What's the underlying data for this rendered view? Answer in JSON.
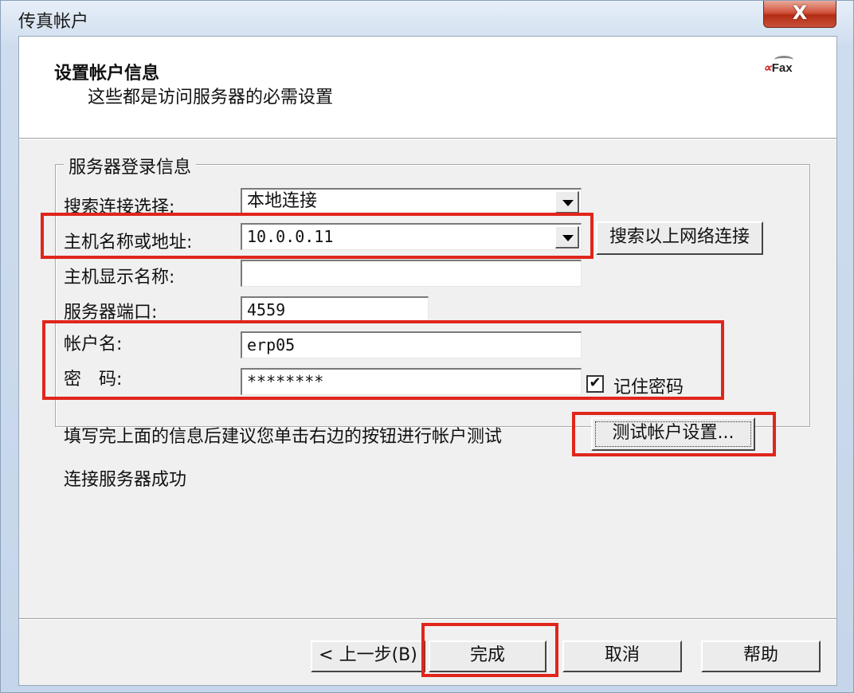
{
  "window": {
    "title": "传真帐户",
    "close_label": "X"
  },
  "header": {
    "title": "设置帐户信息",
    "subtitle": "这些都是访问服务器的必需设置",
    "logo": {
      "accent": "∝",
      "text": "Fax"
    }
  },
  "group": {
    "legend": "服务器登录信息",
    "connection_select": {
      "label": "搜索连接选择:",
      "value": "本地连接"
    },
    "host_address": {
      "label": "主机名称或地址:",
      "value": "10.0.0.11"
    },
    "search_button_label": "搜索以上网络连接",
    "host_display_name": {
      "label": "主机显示名称:",
      "value": ""
    },
    "server_port": {
      "label": "服务器端口:",
      "value": "4559"
    },
    "account_name": {
      "label": "帐户名:",
      "value": "erp05"
    },
    "password": {
      "label": "密　码:",
      "value": "********"
    },
    "remember_password": {
      "label": "记住密码",
      "checked": true,
      "mark": "✔"
    }
  },
  "hint_text": "填写完上面的信息后建议您单击右边的按钮进行帐户测试",
  "test_button_label": "测试帐户设置...",
  "status_text": "连接服务器成功",
  "footer": {
    "back_label": "< 上一步(B)",
    "finish_label": "完成",
    "cancel_label": "取消",
    "help_label": "帮助"
  },
  "colors": {
    "highlight_red": "#e0261c",
    "dialog_bg": "#f0f0f0",
    "close_button": "#c8503a"
  }
}
